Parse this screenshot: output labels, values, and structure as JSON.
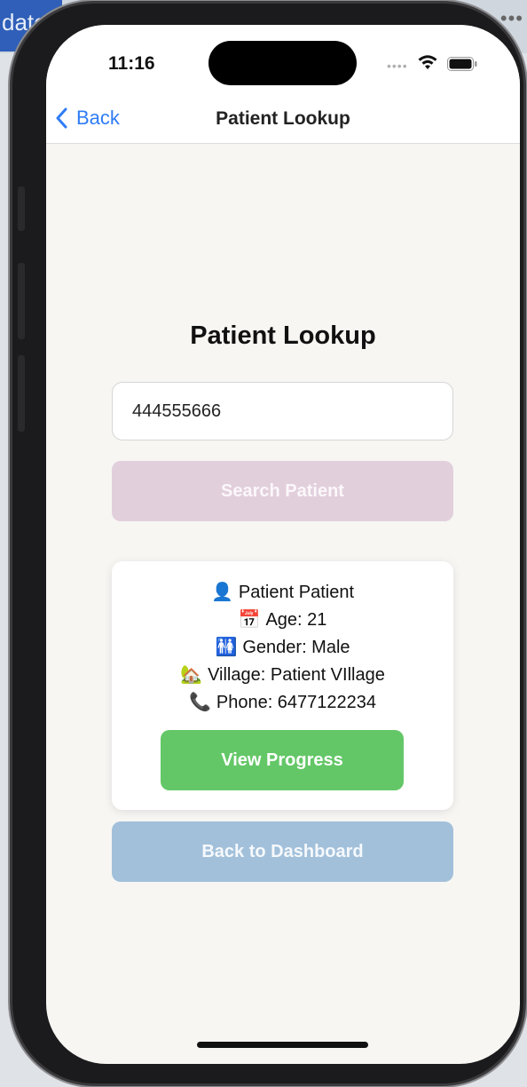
{
  "background": {
    "tab_label": "date",
    "menu_dots": "•••"
  },
  "status_bar": {
    "time": "11:16"
  },
  "nav": {
    "back_label": "Back",
    "title": "Patient Lookup"
  },
  "page": {
    "heading": "Patient Lookup",
    "search_value": "444555666",
    "search_button": "Search Patient",
    "patient": {
      "name": "Patient Patient",
      "age": "Age: 21",
      "gender": "Gender: Male",
      "village": "Village: Patient VIllage",
      "phone": "Phone: 6477122234",
      "icons": {
        "name": "👤",
        "age": "📅",
        "gender": "🚻",
        "village": "🏡",
        "phone": "📞"
      }
    },
    "view_progress_button": "View Progress",
    "back_to_dashboard_button": "Back to Dashboard"
  },
  "colors": {
    "accent_blue": "#2f7cf6",
    "search_button_disabled": "#e2cfdc",
    "view_progress_green": "#63c767",
    "dashboard_button_blue": "#a2c0da",
    "screen_background": "#f7f6f3"
  }
}
